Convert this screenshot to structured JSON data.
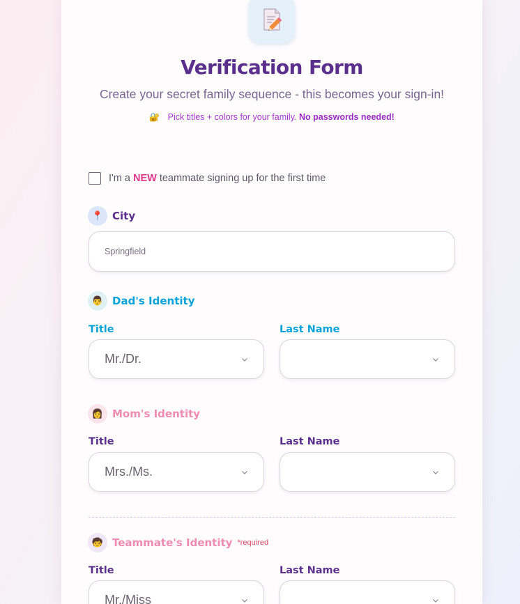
{
  "header": {
    "icon": "memo-pencil-icon",
    "title": "Verification Form",
    "subtitle": "Create your secret family sequence - this becomes your sign-in!",
    "hint_icon": "lock-icon",
    "hint_text": "Pick titles + colors for your family.",
    "hint_bold": "No passwords needed!"
  },
  "new_teammate": {
    "checked": false,
    "prefix": "I'm a",
    "highlight": "NEW",
    "suffix": "teammate signing up for the first time"
  },
  "city": {
    "icon": "pin-icon",
    "label": "City",
    "value": "Springfield"
  },
  "dad": {
    "icon": "man-face-icon",
    "heading": "Dad's Identity",
    "title_label": "Title",
    "title_value": "Mr./Dr.",
    "last_label": "Last Name",
    "last_value": ""
  },
  "mom": {
    "icon": "woman-face-icon",
    "heading": "Mom's Identity",
    "title_label": "Title",
    "title_value": "Mrs./Ms.",
    "last_label": "Last Name",
    "last_value": ""
  },
  "teammate": {
    "icon": "child-face-icon",
    "heading": "Teammate's Identity",
    "required": "*required",
    "title_label": "Title",
    "title_value": "Mr./Miss",
    "last_label": "Last Name",
    "last_value": ""
  },
  "colors": {
    "title_purple": "#5b2f8c",
    "dad_blue": "#0aa2d8",
    "mom_pink": "#f08bb0",
    "hint_purple": "#a239ca",
    "accent_pink": "#e0368a"
  }
}
